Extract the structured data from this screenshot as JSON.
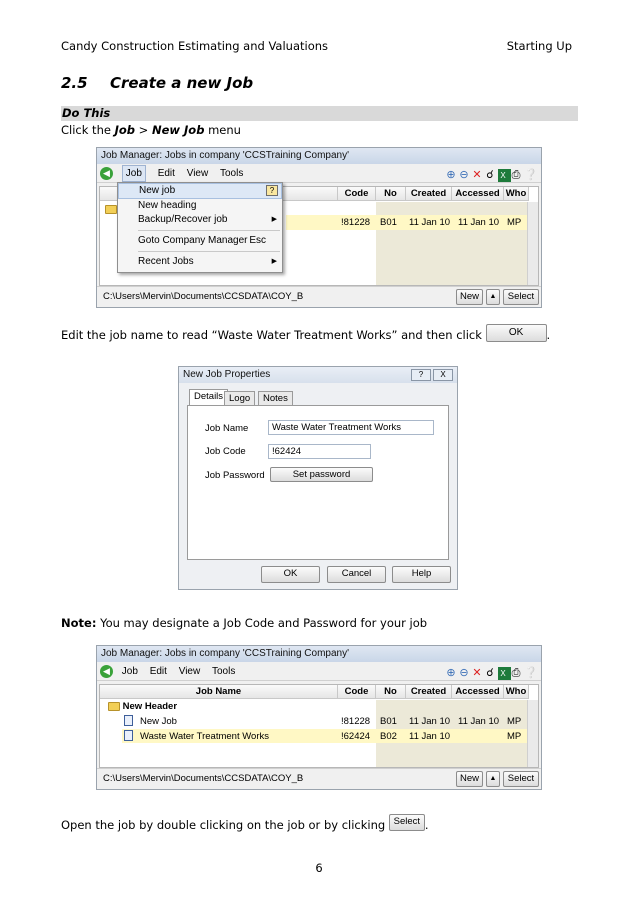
{
  "header": {
    "left": "Candy Construction Estimating and Valuations",
    "right": "Starting Up"
  },
  "section": {
    "number": "2.5",
    "title": "Create a new Job"
  },
  "do_this": "Do This",
  "step1": {
    "prefix": "Click the ",
    "job": "Job",
    "sep": " > ",
    "new_job": "New Job",
    "suffix": " menu"
  },
  "jobmgr": {
    "title": "Job Manager: Jobs in company 'CCSTraining Company'",
    "menus": [
      "Job",
      "Edit",
      "View",
      "Tools"
    ],
    "columns": {
      "job_name": "Job Name",
      "code": "Code",
      "no": "No",
      "created": "Created",
      "accessed": "Accessed",
      "who": "Who"
    },
    "path": "C:\\Users\\Mervin\\Documents\\CCSDATA\\COY_B",
    "new_btn": "New",
    "select_btn": "Select"
  },
  "icons": [
    "zoom-in-icon",
    "zoom-out-icon",
    "delete-icon",
    "find-icon",
    "excel-icon",
    "print-icon",
    "help-icon"
  ],
  "shot1_row": {
    "code": "!81228",
    "no": "B01",
    "created": "11 Jan 10",
    "accessed": "11 Jan 10",
    "who": "MP"
  },
  "dropdown": {
    "items": [
      {
        "label": "New job",
        "shortcut": ""
      },
      {
        "label": "New heading",
        "shortcut": ""
      },
      {
        "label": "Backup/Recover job",
        "shortcut": ""
      },
      {
        "label": "Goto Company Manager",
        "shortcut": "Esc"
      },
      {
        "label": "Recent Jobs",
        "shortcut": ""
      }
    ]
  },
  "step2": {
    "text": "Edit the job name to read “Waste Water Treatment Works” and then click ",
    "ok_btn": "OK",
    "end": "."
  },
  "dialog": {
    "title": "New Job Properties",
    "title_help": "?",
    "title_close": "X",
    "tabs": [
      "Details",
      "Logo",
      "Notes"
    ],
    "fields": {
      "job_name_label": "Job Name",
      "job_name_value": "Waste Water Treatment Works",
      "job_code_label": "Job Code",
      "job_code_value": "!62424",
      "job_password_label": "Job Password",
      "set_password": "Set password"
    },
    "buttons": {
      "ok": "OK",
      "cancel": "Cancel",
      "help": "Help"
    }
  },
  "note": {
    "label": "Note:",
    "text": " You may designate a Job Code and Password for your job"
  },
  "shot2": {
    "header_row": "New Header",
    "rows": [
      {
        "name": "New Job",
        "code": "!81228",
        "no": "B01",
        "created": "11 Jan 10",
        "accessed": "11 Jan 10",
        "who": "MP"
      },
      {
        "name": "Waste Water Treatment Works",
        "code": "!62424",
        "no": "B02",
        "created": "11 Jan 10",
        "accessed": "",
        "who": "MP"
      }
    ]
  },
  "step3": {
    "text": "Open the job by double clicking on the job or by clicking ",
    "select_btn": "Select",
    "end": "."
  },
  "page_number": "6"
}
